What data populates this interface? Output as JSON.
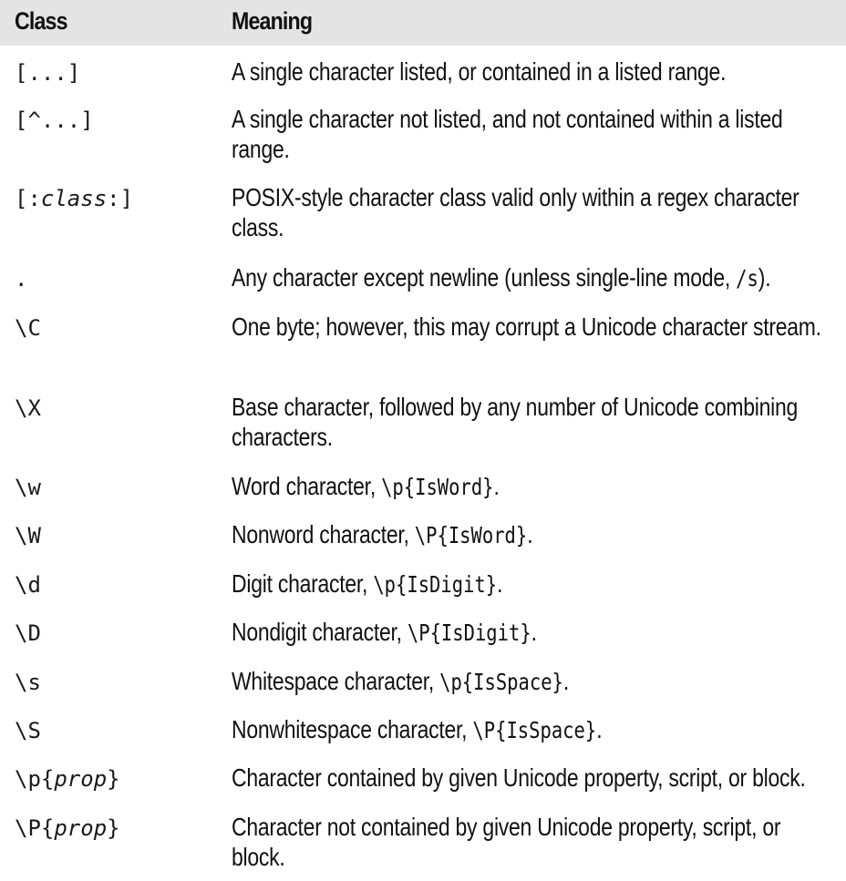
{
  "table": {
    "headers": {
      "class": "Class",
      "meaning": "Meaning"
    },
    "header_bg": "#e4e4e4",
    "rows": [
      {
        "cls": "[...]",
        "meaning_pre": "A single character listed, or contained in a listed range.",
        "code": "",
        "meaning_post": ""
      },
      {
        "cls": "[^...]",
        "meaning_pre": "A single character not listed, and not contained within a listed range.",
        "code": "",
        "meaning_post": ""
      },
      {
        "cls_pre": "[:",
        "cls_italic": "class",
        "cls_post": ":]",
        "meaning_pre": "POSIX-style character class valid only within a regex character class.",
        "code": "",
        "meaning_post": ""
      },
      {
        "cls": ".",
        "meaning_pre": "Any character except newline (unless single-line mode, ",
        "code": "/s",
        "meaning_post": ")."
      },
      {
        "cls": "\\C",
        "meaning_pre": "One byte; however, this may corrupt a Unicode character stream.",
        "code": "",
        "meaning_post": ""
      },
      {
        "cls": "\\X",
        "meaning_pre": "Base character, followed by any number of Unicode combining characters.",
        "code": "",
        "meaning_post": ""
      },
      {
        "cls": "\\w",
        "meaning_pre": "Word character, ",
        "code": "\\p{IsWord}",
        "meaning_post": "."
      },
      {
        "cls": "\\W",
        "meaning_pre": "Nonword character, ",
        "code": "\\P{IsWord}",
        "meaning_post": "."
      },
      {
        "cls": "\\d",
        "meaning_pre": "Digit character, ",
        "code": "\\p{IsDigit}",
        "meaning_post": "."
      },
      {
        "cls": "\\D",
        "meaning_pre": "Nondigit character, ",
        "code": "\\P{IsDigit}",
        "meaning_post": "."
      },
      {
        "cls": "\\s",
        "meaning_pre": "Whitespace character, ",
        "code": "\\p{IsSpace}",
        "meaning_post": "."
      },
      {
        "cls": "\\S",
        "meaning_pre": "Nonwhitespace character, ",
        "code": "\\P{IsSpace}",
        "meaning_post": "."
      },
      {
        "cls_pre": "\\p{",
        "cls_italic": "prop",
        "cls_post": "}",
        "meaning_pre": "Character contained by given Unicode property, script, or block.",
        "code": "",
        "meaning_post": ""
      },
      {
        "cls_pre": "\\P{",
        "cls_italic": "prop",
        "cls_post": "}",
        "meaning_pre": "Character not contained by given Unicode property, script, or block.",
        "code": "",
        "meaning_post": ""
      }
    ]
  }
}
